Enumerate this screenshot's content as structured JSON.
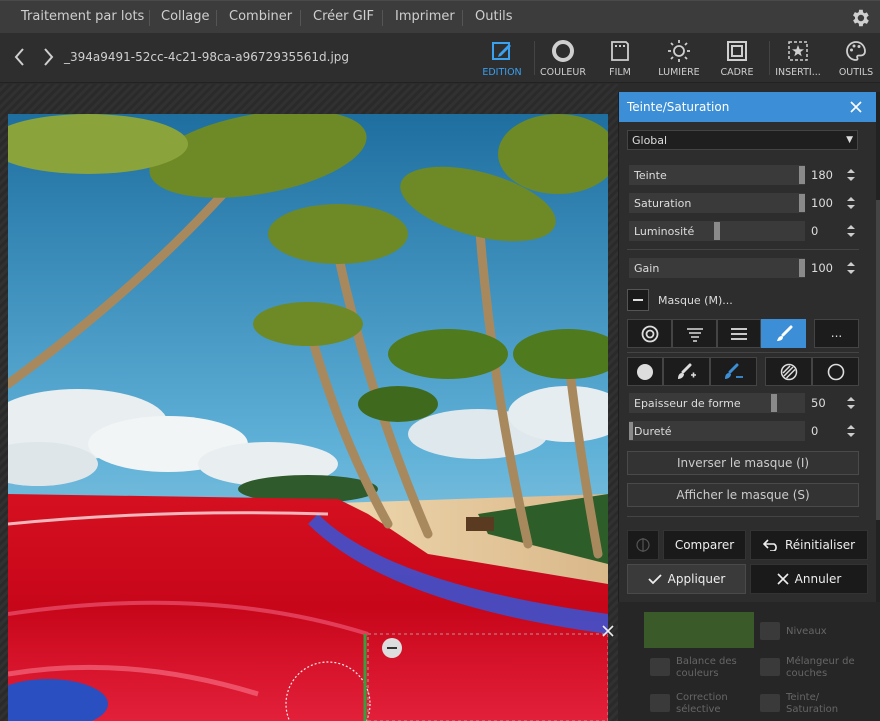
{
  "menu": {
    "items": [
      "Traitement par lots",
      "Collage",
      "Combiner",
      "Créer GIF",
      "Imprimer",
      "Outils"
    ]
  },
  "toolbar": {
    "filename": "_394a9491-52cc-4c21-98ca-a9672935561d.jpg",
    "tools": [
      {
        "label": "EDITION",
        "icon": "edit-icon",
        "active": true
      },
      {
        "label": "COULEUR",
        "icon": "color-circle-icon",
        "active": false
      },
      {
        "label": "FILM",
        "icon": "film-icon",
        "active": false
      },
      {
        "label": "LUMIÈRE",
        "icon": "sun-icon",
        "active": false
      },
      {
        "label": "CADRE",
        "icon": "frame-icon",
        "active": false
      },
      {
        "label": "INSERTI...",
        "icon": "insert-star-icon",
        "active": false
      },
      {
        "label": "OUTILS",
        "icon": "palette-icon",
        "active": false
      }
    ]
  },
  "panel": {
    "title": "Teinte/Saturation",
    "channel_select": "Global",
    "sliders": {
      "teinte": {
        "label": "Teinte",
        "value": "180"
      },
      "saturation": {
        "label": "Saturation",
        "value": "100"
      },
      "luminosite": {
        "label": "Luminosité",
        "value": "0"
      },
      "gain": {
        "label": "Gain",
        "value": "100"
      },
      "epaisseur": {
        "label": "Epaisseur de forme",
        "value": "50"
      },
      "durete": {
        "label": "Dureté",
        "value": "0"
      }
    },
    "mask_label": "Masque (M)...",
    "more_label": "...",
    "invert_mask": "Inverser le masque (I)",
    "show_mask": "Afficher le masque (S)",
    "compare": "Comparer",
    "reset": "Réinitialiser",
    "apply": "Appliquer",
    "cancel": "Annuler"
  },
  "background_tools": {
    "levels": "Niveaux",
    "color_balance": "Balance des couleurs",
    "layer_mixer": "Mélangeur de couches",
    "selective_correction": "Correction sélective",
    "hue_saturation": "Teinte/ Saturation"
  },
  "colors": {
    "accent": "#3c8fd6",
    "menubar": "#3c3c3c",
    "panel": "#2d2d2d"
  }
}
